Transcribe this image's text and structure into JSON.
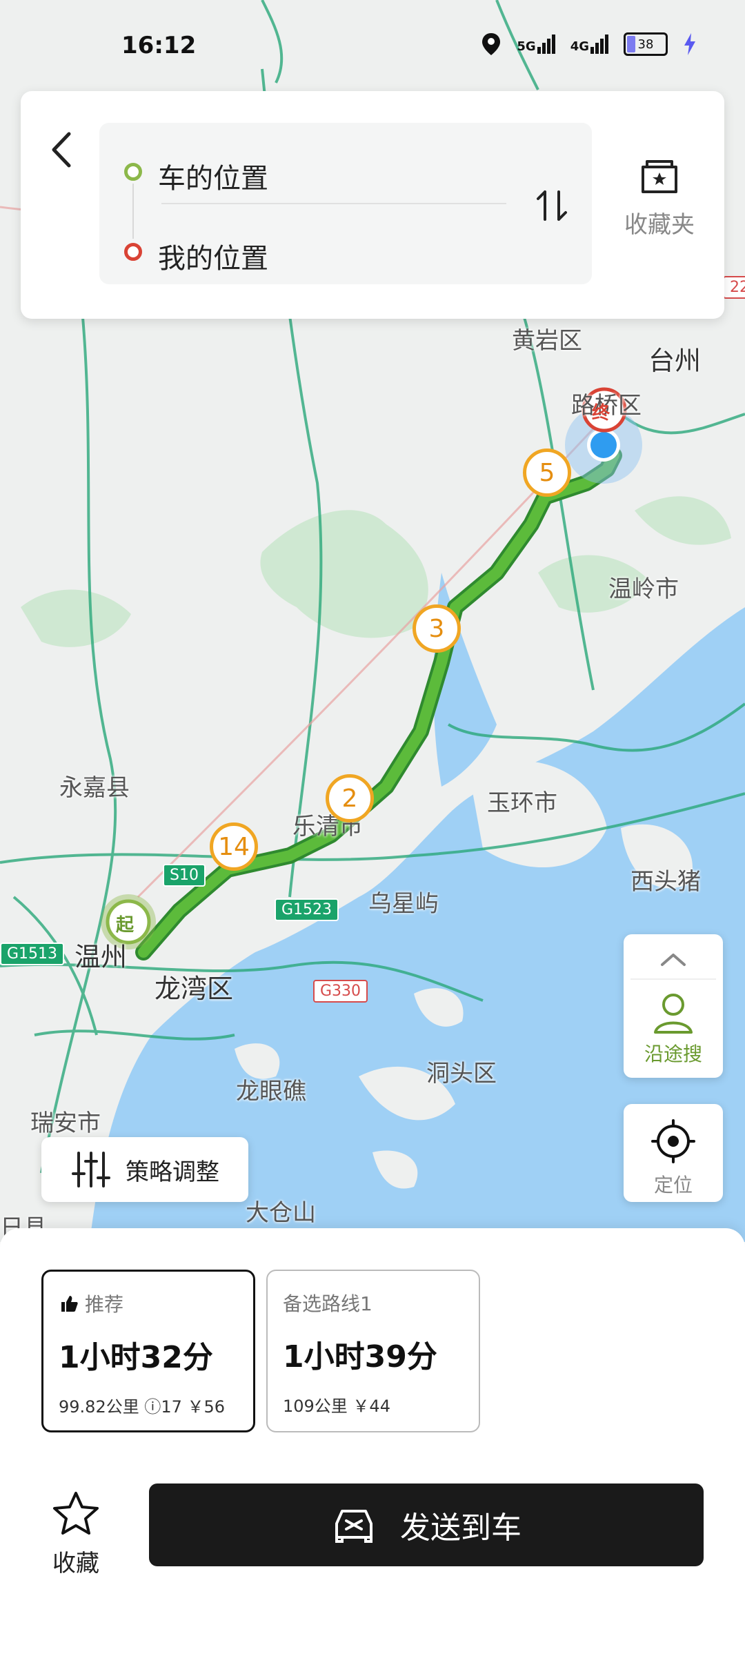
{
  "status_bar": {
    "time": "16:12",
    "network_1": "5G",
    "network_2": "4G",
    "battery": "38"
  },
  "search": {
    "from": "车的位置",
    "to": "我的位置",
    "favorites_label": "收藏夹"
  },
  "map": {
    "labels": {
      "huangyan": "黄岩区",
      "taizhou": "台州",
      "luqiao": "路桥区",
      "wenling": "温岭市",
      "yongjia": "永嘉县",
      "yueqing": "乐清市",
      "yuhuan": "玉环市",
      "xitouzhu": "西头猪",
      "wuxingyu": "乌星屿",
      "wenzhou": "温州",
      "longwan": "龙湾区",
      "dongtou": "洞头区",
      "longyanjiao": "龙眼礁",
      "ruian": "瑞安市",
      "dacangshan": "大仓山",
      "edge_county": "日县"
    },
    "shields": {
      "s10": "S10",
      "g1523": "G1523",
      "g1513": "G1513",
      "g330": "G330",
      "edge22": "22"
    },
    "markers": {
      "m5": "5",
      "m3": "3",
      "m2": "2",
      "m14": "14",
      "start": "起",
      "end": "终"
    },
    "along_search_label": "沿途搜",
    "locate_label": "定位",
    "strategy_label": "策略调整"
  },
  "routes": [
    {
      "tag": "推荐",
      "time": "1小时32分",
      "meta": "99.82公里 ⓘ17 ￥56"
    },
    {
      "tag": "备选路线1",
      "time": "1小时39分",
      "meta": "109公里 ￥44"
    }
  ],
  "actions": {
    "favorite_label": "收藏",
    "send_label": "发送到车"
  },
  "colors": {
    "route": "#3aa63a",
    "water": "#9fd0f5",
    "accent": "#6a9a2f",
    "send": "#1a1a1a"
  }
}
